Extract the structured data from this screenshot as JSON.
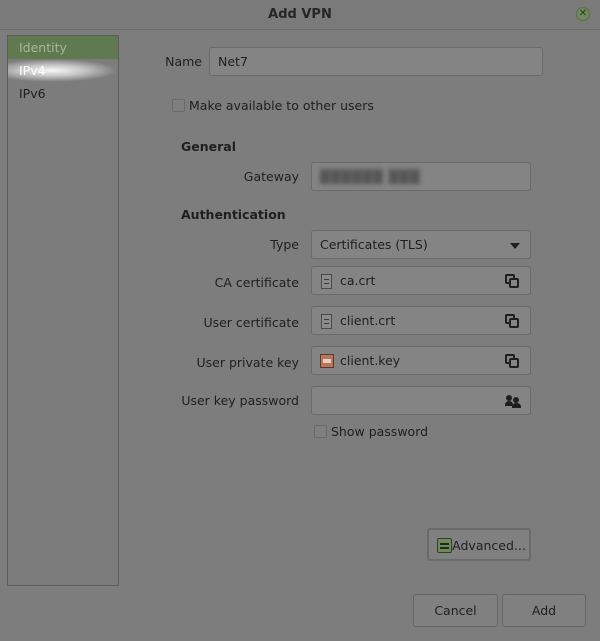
{
  "window": {
    "title": "Add VPN"
  },
  "sidebar": {
    "items": [
      {
        "label": "Identity"
      },
      {
        "label": "IPv4"
      },
      {
        "label": "IPv6"
      }
    ]
  },
  "form": {
    "name_label": "Name",
    "name_value": "Net7",
    "available_label": "Make available to other users",
    "general_heading": "General",
    "gateway_label": "Gateway",
    "gateway_value": "██████ ███",
    "auth_heading": "Authentication",
    "type_label": "Type",
    "type_value": "Certificates (TLS)",
    "ca_label": "CA certificate",
    "ca_value": "ca.crt",
    "user_cert_label": "User certificate",
    "user_cert_value": "client.crt",
    "private_key_label": "User private key",
    "private_key_value": "client.key",
    "key_password_label": "User key password",
    "key_password_value": "",
    "show_password_label": "Show password"
  },
  "buttons": {
    "advanced": "Advanced...",
    "cancel": "Cancel",
    "add": "Add"
  },
  "colors": {
    "accent": "#5f7a4f",
    "background": "#7d7d7d"
  }
}
